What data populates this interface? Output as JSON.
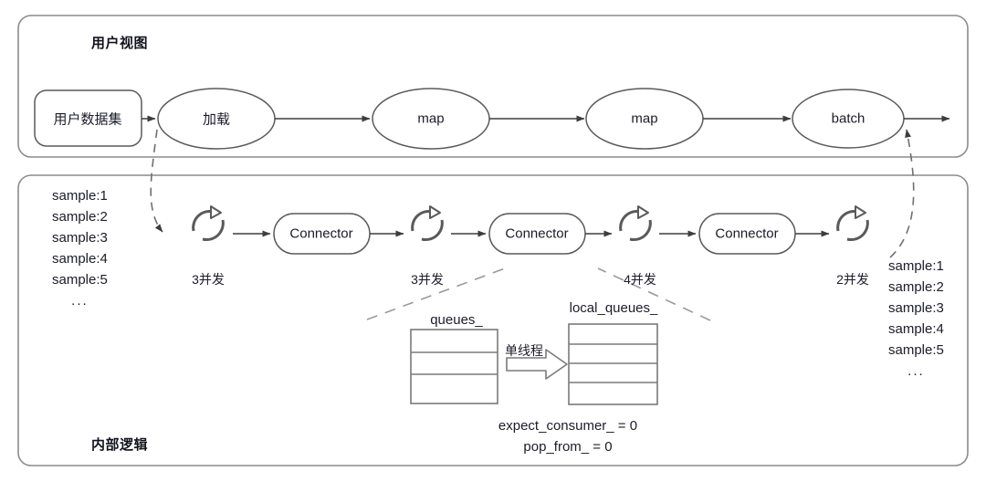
{
  "diagram": {
    "panels": [
      {
        "id": "user-view",
        "title": "用户视图"
      },
      {
        "id": "internal-logic",
        "title": "内部逻辑"
      }
    ],
    "user_view": {
      "dataset_box": {
        "label": "用户数据集"
      },
      "stages": [
        {
          "label": "加载"
        },
        {
          "label": "map"
        },
        {
          "label": "map"
        },
        {
          "label": "batch"
        }
      ]
    },
    "internal_logic": {
      "input_samples": {
        "items": [
          "sample:1",
          "sample:2",
          "sample:3",
          "sample:4",
          "sample:5"
        ],
        "ellipsis": "..."
      },
      "output_samples": {
        "items": [
          "sample:1",
          "sample:2",
          "sample:3",
          "sample:4",
          "sample:5"
        ],
        "ellipsis": "..."
      },
      "workers": [
        {
          "icon": "cycle-icon",
          "concurrency_label": "3并发"
        },
        {
          "icon": "cycle-icon",
          "concurrency_label": "3并发"
        },
        {
          "icon": "cycle-icon",
          "concurrency_label": "4并发"
        },
        {
          "icon": "cycle-icon",
          "concurrency_label": "2并发"
        }
      ],
      "connectors": [
        {
          "label": "Connector"
        },
        {
          "label": "Connector"
        },
        {
          "label": "Connector"
        }
      ],
      "detail": {
        "source_queue": {
          "title": "queues_",
          "rows": 3
        },
        "target_queue": {
          "title": "local_queues_",
          "rows": 4
        },
        "transfer_label": "单线程",
        "variables": [
          "expect_consumer_ = 0",
          "pop_from_ = 0"
        ]
      }
    },
    "colors": {
      "panel_border": "#8c8c8c",
      "shape_stroke": "#5a5a5a",
      "arrow": "#3d3d3d",
      "dashed": "#8c8c8c",
      "text": "#1c1c2b"
    }
  }
}
